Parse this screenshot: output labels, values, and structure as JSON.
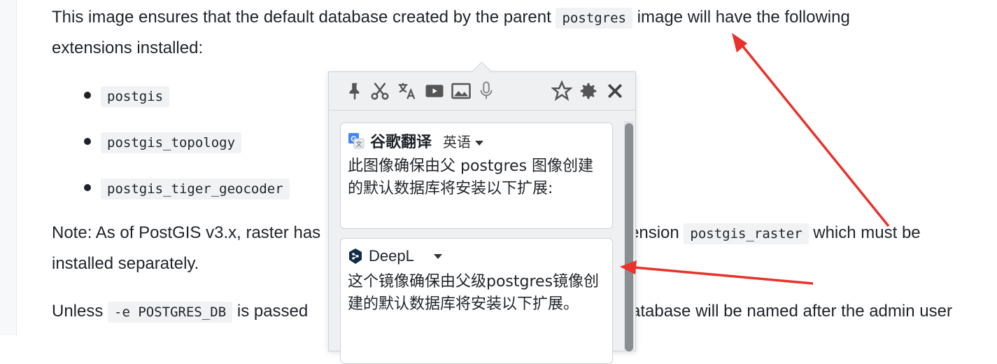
{
  "doc": {
    "p1_text_a": "This image ensures that the default database created by the parent",
    "p1_code": "postgres",
    "p1_text_b": "image will have the following",
    "p1_line2": "extensions installed:",
    "extensions": [
      "postgis",
      "postgis_topology",
      "postgis_tiger_geocoder"
    ],
    "note_text_a": "Note: As of PostGIS v3.x, raster has",
    "note_text_b": "ension",
    "note_code": "postgis_raster",
    "note_text_c": "which must be",
    "note_line2": "installed separately.",
    "unless_text_a": "Unless",
    "unless_code": "-e POSTGRES_DB",
    "unless_text_b": "is passed",
    "unless_text_c": "atabase will be named after the admin user"
  },
  "popup": {
    "toolbar": {
      "icons": [
        "pin-icon",
        "scissors-icon",
        "translate-icon",
        "video-icon",
        "image-icon",
        "microphone-icon",
        "star-icon",
        "gear-icon",
        "close-icon"
      ]
    },
    "google": {
      "name": "谷歌翻译",
      "lang": "英语",
      "text": "此图像确保由父 postgres 图像创建的默认数据库将安装以下扩展:"
    },
    "deepl": {
      "name": "DeepL",
      "text": "这个镜像确保由父级postgres镜像创建的默认数据库将安装以下扩展。"
    }
  },
  "colors": {
    "annotation_arrow": "#e8322b",
    "google_blue": "#4285f4",
    "deepl_navy": "#0f2b46"
  }
}
